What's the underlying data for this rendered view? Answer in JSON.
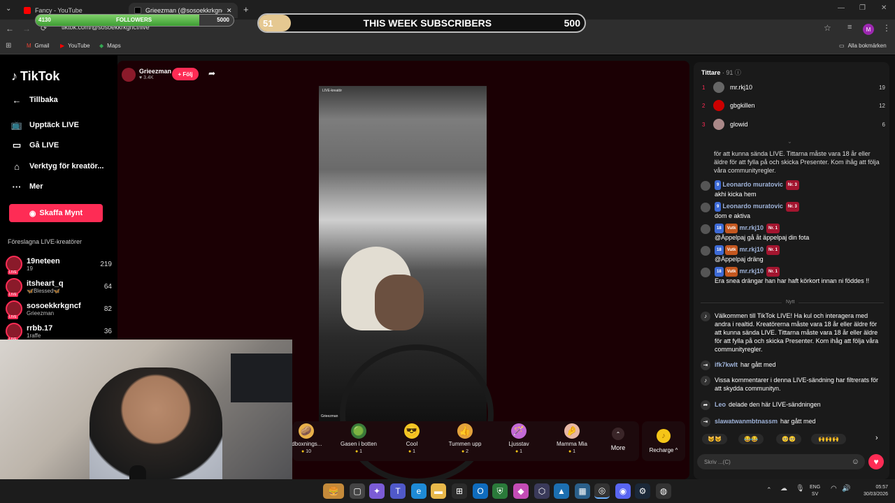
{
  "browser": {
    "tabs": [
      {
        "title": "Fancy - YouTube",
        "active": false,
        "favicon_color": "#ff0000"
      },
      {
        "title": "Grieezman (@sosoekkrkgnc",
        "active": true,
        "favicon_color": "#111111"
      }
    ],
    "url": "tiktok.com/@sosoekkrkgncf/live",
    "bookmarks": [
      "Gmail",
      "YouTube",
      "Maps"
    ],
    "all_bookmarks": "Alla bokmärken",
    "profile_initial": "M"
  },
  "overlay": {
    "followers_current": "4130",
    "followers_label": "FOLLOWERS",
    "followers_goal": "5000",
    "followers_progress": 0.826,
    "subs_current": "51",
    "subs_label": "THIS WEEK SUBSCRIBERS",
    "subs_goal": "500",
    "subs_progress": 0.102
  },
  "sidebar": {
    "logo": "TikTok",
    "back": "Tillbaka",
    "items": [
      {
        "label": "Upptäck LIVE",
        "icon": "tv-icon"
      },
      {
        "label": "Gå LIVE",
        "icon": "video-camera-icon"
      },
      {
        "label": "Verktyg för kreatör...",
        "icon": "home-tools-icon"
      },
      {
        "label": "Mer",
        "icon": "more-dots-icon"
      }
    ],
    "coins_button": "Skaffa Mynt",
    "suggested_heading": "Föreslagna LIVE-kreatörer",
    "creators": [
      {
        "name": "19neteen",
        "sub": "19",
        "count": "219"
      },
      {
        "name": "itsheart_q",
        "sub": "🦋Blessed🦋",
        "count": "64"
      },
      {
        "name": "sosoekkrkgncf",
        "sub": "Grieezman",
        "count": "82"
      },
      {
        "name": "rrbb.17",
        "sub": "1raffe",
        "count": "36"
      }
    ]
  },
  "stream": {
    "host_name": "Grieezman",
    "host_likes": "♥ 3.4K",
    "follow_button": "+ Följ",
    "video_tag": "LIVE-kreatör",
    "video_footer": "Grieezman"
  },
  "gifts": [
    {
      "name": "idboxnings...",
      "price": "10",
      "emoji": "🥔",
      "color": "#e8b04a"
    },
    {
      "name": "Gasen i botten",
      "price": "1",
      "emoji": "🟢",
      "color": "#3a7a3a"
    },
    {
      "name": "Cool",
      "price": "1",
      "emoji": "😎",
      "color": "#f3c623"
    },
    {
      "name": "Tummen upp",
      "price": "2",
      "emoji": "👍",
      "color": "#e3a23c"
    },
    {
      "name": "Ljusstav",
      "price": "1",
      "emoji": "🪄",
      "color": "#c36ad6"
    },
    {
      "name": "Mamma Mia",
      "price": "1",
      "emoji": "🤌",
      "color": "#e7b7a5"
    }
  ],
  "gift_more": "More",
  "recharge": "Recharge ^",
  "chat": {
    "viewers_title": "Tittare",
    "viewers_count": "· 91",
    "top_viewers": [
      {
        "rank": "1",
        "name": "mr.rkj10",
        "score": "19"
      },
      {
        "rank": "2",
        "name": "gbgkillen",
        "score": "12"
      },
      {
        "rank": "3",
        "name": "glowid",
        "score": "6"
      }
    ],
    "top_text": "för att kunna sända LIVE. Tittarna måste vara 18 år eller äldre för att fylla på och skicka Presenter. Kom ihåg att följa våra communityregler.",
    "messages": [
      {
        "level": "9",
        "user": "Leonardo muratovic",
        "rank": "Nr. 3",
        "text": "akhi kicka hem"
      },
      {
        "level": "9",
        "user": "Leonardo muratovic",
        "rank": "Nr. 3",
        "text": "dom e aktiva"
      },
      {
        "level": "18",
        "fan": "Vutk",
        "user": "mr.rkj10",
        "rank": "Nr. 1",
        "text": "@Äppelpaj gå åt äppelpaj din fota"
      },
      {
        "level": "18",
        "fan": "Vutk",
        "user": "mr.rkj10",
        "rank": "Nr. 1",
        "text": "@Äppelpaj dräng"
      },
      {
        "level": "18",
        "fan": "Vutk",
        "user": "mr.rkj10",
        "rank": "Nr. 1",
        "text": "Era snea drängar han har haft körkort innan ni föddes !!"
      }
    ],
    "divider": "Nytt",
    "welcome": "Välkommen till TikTok LIVE! Ha kul och interagera med andra i realtid. Kreatörerna måste vara 18 år eller äldre för att kunna sända LIVE. Tittarna måste vara 18 år eller äldre för att fylla på och skicka Presenter. Kom ihåg att följa våra communityregler.",
    "joined1_user": "ifk7kwlt",
    "joined1_text": "har gått med",
    "filtered": "Vissa kommentarer i denna LIVE-sändning har filtrerats för att skydda communityn.",
    "shared_user": "Leo",
    "shared_text": "delade den här LIVE-sändningen",
    "joined2_user": "slawatwanmbtnassm",
    "joined2_text": "har gått med",
    "emoji_chips": [
      "😺😺",
      "😂😂",
      "🥺🥺",
      "🙌🙌🙌"
    ],
    "input_placeholder": "Skriv ...(C)"
  },
  "taskbar": {
    "lang": "ENG",
    "lang2": "SV",
    "time": "05:57",
    "date": "30/03/2026"
  }
}
